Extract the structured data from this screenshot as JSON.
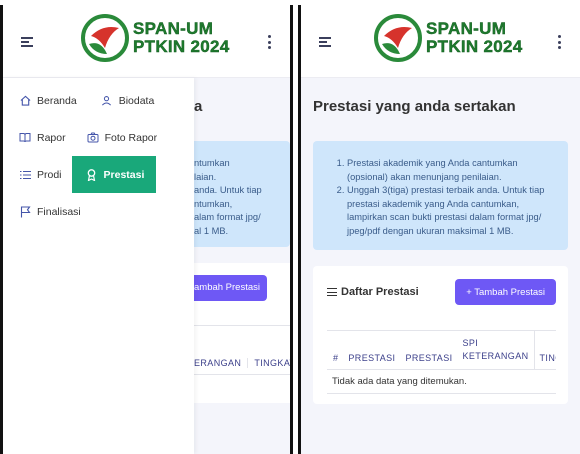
{
  "app": {
    "logo_line1": "SPAN-UM",
    "logo_line2": "PTKIN 2024",
    "accent": "#19a87a",
    "button_color": "#6e58f5",
    "info_bg": "#cfe6fb"
  },
  "menu": {
    "items": [
      {
        "label": "Beranda",
        "icon": "home-icon"
      },
      {
        "label": "Biodata",
        "icon": "user-icon"
      },
      {
        "label": "Rapor",
        "icon": "book-icon"
      },
      {
        "label": "Foto Rapor",
        "icon": "camera-icon"
      },
      {
        "label": "Prodi",
        "icon": "list-icon"
      },
      {
        "label": "Prestasi",
        "icon": "award-icon",
        "active": true
      },
      {
        "label": "Finalisasi",
        "icon": "flag-icon"
      }
    ]
  },
  "left_peek": {
    "title_fragment": "a",
    "info_lines": [
      "ntumkan",
      "laian.",
      "anda. Untuk tiap",
      "ntumkan,",
      "alam format jpg/",
      "al 1 MB."
    ],
    "button_fragment": "ambah Prestasi",
    "header_fragments": [
      "ERANGAN",
      "TINGKAT"
    ]
  },
  "page": {
    "title": "Prestasi yang anda sertakan",
    "info": [
      "Prestasi akademik yang Anda cantumkan (opsional) akan menunjang penilaian.",
      "Unggah 3(tiga) prestasi terbaik anda. Untuk tiap prestasi akademik yang Anda cantumkan, lampirkan scan bukti prestasi dalam format jpg/ jpeg/pdf dengan ukuran maksimal 1 MB."
    ],
    "list_title": "Daftar Prestasi",
    "add_button": "+ Tambah Prestasi",
    "table": {
      "headers": [
        "#",
        "PRESTASI",
        "PRESTASI",
        "SPI",
        "KETERANGAN",
        "TINGKAT"
      ],
      "empty_message": "Tidak ada data yang ditemukan."
    }
  }
}
